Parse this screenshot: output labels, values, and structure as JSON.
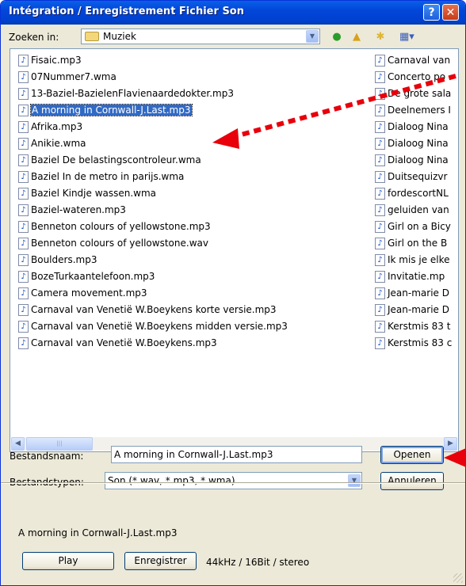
{
  "window": {
    "title": "Intégration / Enregistrement Fichier Son",
    "help_label": "?",
    "close_label": "✕"
  },
  "toolbar": {
    "lookin_label": "Zoeken in:",
    "lookin_value": "Muziek",
    "icons": [
      "back-icon",
      "up-folder-icon",
      "new-folder-icon",
      "view-menu-icon"
    ]
  },
  "files_col1": [
    "Fisaic.mp3",
    "07Nummer7.wma",
    "13-Baziel-BazielenFlavienaardedokter.mp3",
    "A morning in Cornwall-J.Last.mp3",
    "Afrika.mp3",
    "Anikie.wma",
    "Baziel  De belastingscontroleur.wma",
    "Baziel In de metro in parijs.wma",
    "Baziel Kindje wassen.wma",
    "Baziel-wateren.mp3",
    "Benneton colours of yellowstone.mp3",
    "Benneton colours of yellowstone.wav",
    "Boulders.mp3",
    "BozeTurkaantelefoon.mp3",
    "Camera movement.mp3",
    "Carnaval van Venetië W.Boeykens korte versie.mp3",
    "Carnaval van Venetië W.Boeykens midden versie.mp3",
    "Carnaval van Venetië W.Boeykens.mp3"
  ],
  "files_col2": [
    "Carnaval van",
    "Concerto po",
    "De grote sala",
    "Deelnemers I",
    "Dialoog Nina",
    "Dialoog Nina",
    "Dialoog Nina",
    "Duitsequizvr",
    "fordescortNL",
    "geluiden van",
    "Girl on a Bicy",
    "Girl on the  B",
    "Ik mis je elke",
    "Invitatie.mp",
    "Jean-marie D",
    "Jean-marie D",
    "Kerstmis 83 t",
    "Kerstmis 83 c"
  ],
  "selected_file": "A morning in Cornwall-J.Last.mp3",
  "filename": {
    "label": "Bestandsnaam:",
    "value": "A morning in Cornwall-J.Last.mp3"
  },
  "filetype": {
    "label": "Bestandstypen:",
    "value": "Son (*.wav, *.mp3, *.wma)"
  },
  "buttons": {
    "open": "Openen",
    "cancel": "Annuleren",
    "play": "Play",
    "record": "Enregistrer"
  },
  "status": {
    "current_file": "A morning in Cornwall-J.Last.mp3",
    "format": "44kHz / 16Bit / stereo"
  },
  "colors": {
    "annotation_arrow": "#e8000b",
    "selection": "#316ac5",
    "titlebar": "#0246d9"
  }
}
